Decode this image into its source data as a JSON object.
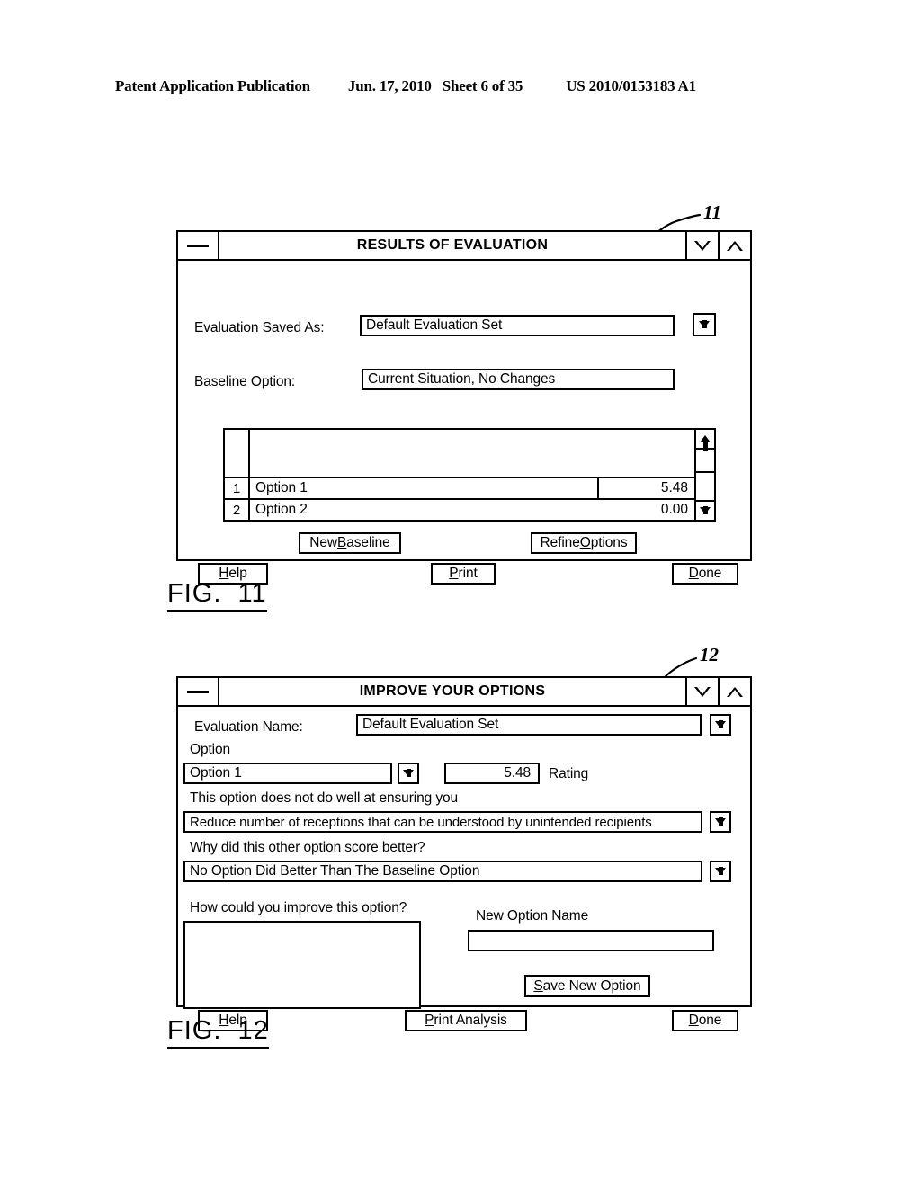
{
  "page": {
    "header": {
      "publication": "Patent Application Publication",
      "date": "Jun. 17, 2010",
      "sheet": "Sheet 6 of 35",
      "patent_number": "US 2010/0153183 A1"
    }
  },
  "figure11": {
    "caption": "FIG.  11",
    "reference_numeral": "11",
    "window": {
      "title": "RESULTS OF EVALUATION",
      "sysmenu_icon": "minimize-bar-icon",
      "minimize_icon": "triangle-down-icon",
      "maximize_icon": "triangle-up-icon"
    },
    "fields": {
      "saved_as_label": "Evaluation Saved As:",
      "saved_as_value": "Default Evaluation Set",
      "saved_as_dropdown_icon": "arrow-down-icon",
      "baseline_label": "Baseline Option:",
      "baseline_value": "Current Situation, No Changes"
    },
    "list": {
      "scroll_up_icon": "arrow-up-icon",
      "scroll_down_icon": "arrow-down-icon",
      "rows": [
        {
          "index": "1",
          "name": "Option 1",
          "value": "5.48"
        },
        {
          "index": "2",
          "name": "Option 2",
          "value": "0.00"
        }
      ]
    },
    "buttons": {
      "new_baseline": "New Baseline",
      "new_baseline_pre": "New ",
      "new_baseline_mn": "B",
      "new_baseline_post": "aseline",
      "refine_options_pre": "Refine ",
      "refine_options_mn": "O",
      "refine_options_post": "ptions",
      "help_mn": "H",
      "help_post": "elp",
      "print_mn": "P",
      "print_post": "rint",
      "done_mn": "D",
      "done_post": "one"
    }
  },
  "figure12": {
    "caption": "FIG.  12",
    "reference_numeral": "12",
    "window": {
      "title": "IMPROVE YOUR OPTIONS",
      "sysmenu_icon": "minimize-bar-icon",
      "minimize_icon": "triangle-down-icon",
      "maximize_icon": "triangle-up-icon"
    },
    "fields": {
      "eval_name_label": "Evaluation Name:",
      "eval_name_value": "Default Evaluation Set",
      "eval_name_dropdown_icon": "arrow-down-icon",
      "option_label": "Option",
      "option_value": "Option 1",
      "option_dropdown_icon": "arrow-down-icon",
      "rating_value": "5.48",
      "rating_label": "Rating",
      "weakness_label": "This option does not do well at ensuring you",
      "weakness_value": "Reduce number of receptions that can be understood by unintended recipients",
      "weakness_dropdown_icon": "arrow-down-icon",
      "better_label": "Why did this other option score better?",
      "better_value": "No Option Did Better Than The Baseline Option",
      "better_dropdown_icon": "arrow-down-icon",
      "improve_label": "How could you improve this option?",
      "improve_value": "",
      "new_option_name_label": "New Option Name",
      "new_option_name_value": ""
    },
    "buttons": {
      "save_new_option_mn": "S",
      "save_new_option_post": "ave New Option",
      "help_mn": "H",
      "help_post": "elp",
      "print_analysis_mn": "P",
      "print_analysis_post": "rint Analysis",
      "done_mn": "D",
      "done_post": "one"
    }
  }
}
